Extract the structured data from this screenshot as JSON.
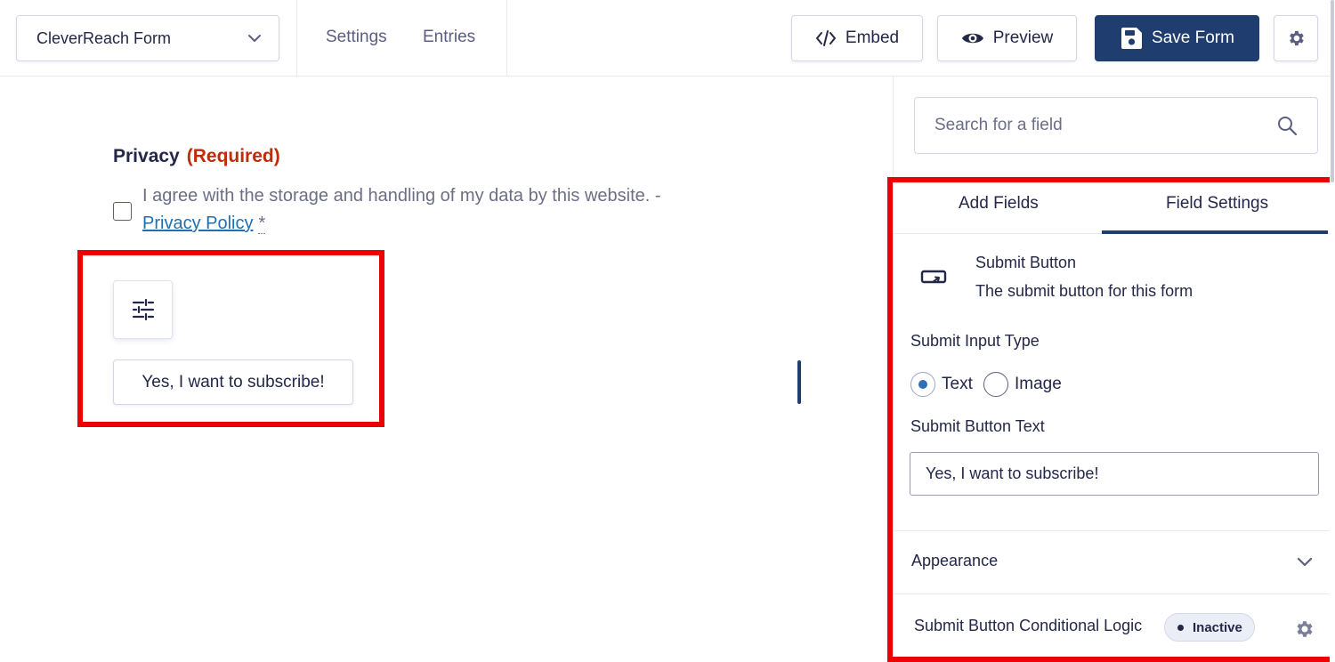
{
  "topbar": {
    "form_name": "CleverReach Form",
    "links": {
      "settings": "Settings",
      "entries": "Entries"
    },
    "buttons": {
      "embed": "Embed",
      "preview": "Preview",
      "save": "Save Form"
    }
  },
  "canvas": {
    "privacy": {
      "label": "Privacy",
      "required": "(Required)",
      "consent_text": "I agree with the storage and handling of my data by this website. -",
      "policy_link": "Privacy Policy",
      "required_star": "*",
      "checked": false
    },
    "submit_button_text": "Yes, I want to subscribe!"
  },
  "panel": {
    "search_placeholder": "Search for a field",
    "tabs": {
      "add_fields": "Add Fields",
      "field_settings": "Field Settings"
    },
    "active_tab": "field_settings",
    "field": {
      "title": "Submit Button",
      "description": "The submit button for this form"
    },
    "input_type": {
      "label": "Submit Input Type",
      "options": {
        "text": "Text",
        "image": "Image"
      },
      "selected": "Text"
    },
    "button_text": {
      "label": "Submit Button Text",
      "value": "Yes, I want to subscribe!"
    },
    "appearance": "Appearance",
    "conditional_logic": {
      "label": "Submit Button Conditional Logic",
      "status": "Inactive"
    }
  },
  "colors": {
    "primary": "#1f3d6f",
    "required": "#c02b0a",
    "link": "#1f6fb2",
    "highlight": "#ee0000"
  }
}
